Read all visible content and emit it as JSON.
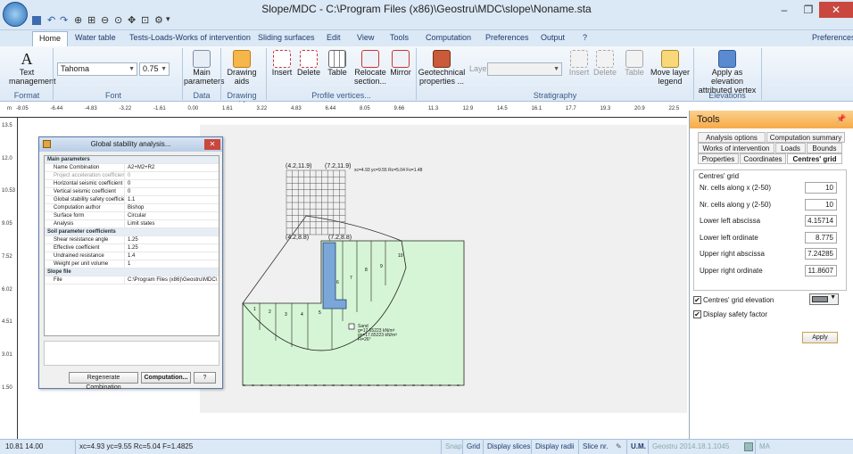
{
  "window": {
    "title": "Slope/MDC - C:\\Program Files (x86)\\Geostru\\MDC\\slope\\Noname.sta"
  },
  "tabs": [
    "Home",
    "Water table",
    "Tests-Loads-Works of intervention",
    "Sliding surfaces",
    "Edit",
    "View",
    "Tools",
    "Computation",
    "Preferences",
    "Output",
    "?"
  ],
  "preferences_link": "Preferences",
  "ribbon": {
    "text_management": "Text management",
    "font_name": "Tahoma",
    "font_size": "0.75",
    "main_parameters": "Main parameters",
    "drawing_aids": "Drawing aids",
    "insert": "Insert",
    "delete": "Delete",
    "table": "Table",
    "relocate_section": "Relocate section...",
    "mirror": "Mirror",
    "geotechnical_properties": "Geotechnical properties ...",
    "layer": "Layer",
    "insert2": "Insert",
    "delete2": "Delete",
    "table2": "Table",
    "move_layer_legend": "Move layer legend",
    "apply_elevation": "Apply as elevation attributed vertex",
    "groups": {
      "format": "Format",
      "font": "Font",
      "data": "Data",
      "drawing_aids": "Drawing aids",
      "profile": "Profile vertices...",
      "stratigraphy": "Stratigraphy",
      "elevations": "Elevations"
    }
  },
  "ruler": {
    "top": [
      "-8.05",
      "-6.44",
      "-4.83",
      "-3.22",
      "-1.61",
      "0.00",
      "1.61",
      "3.22",
      "4.83",
      "6.44",
      "8.05",
      "9.66",
      "11.3",
      "12.9",
      "14.5",
      "16.1",
      "17.7",
      "19.3",
      "20.9",
      "22.5"
    ],
    "top_unit": "m",
    "left": [
      "13.5",
      "12.0",
      "10.53",
      "9.05",
      "7.52",
      "6.02",
      "4.51",
      "3.01",
      "1.50"
    ]
  },
  "drawing": {
    "grid_ul": "(4.2,11.9)",
    "grid_ur": "(7.2,11.9)",
    "grid_ll": "(4.2,8.8)",
    "grid_lr": "(7.2,8.8)",
    "result_label": "xc=4.93 yc=9.55 Rc=5.04 Fs=1.48",
    "slices": [
      "1",
      "2",
      "3",
      "4",
      "5",
      "6",
      "7",
      "8",
      "9",
      "10"
    ],
    "soil_name": "Sand",
    "soil_lines": [
      "g=17.65223 kN/m³",
      "gs=17.65223 kN/m³",
      "Fi=26°"
    ]
  },
  "dialog": {
    "title": "Global stability analysis...",
    "close": "✕",
    "sections": [
      {
        "title": "Main parameters",
        "rows": [
          {
            "k": "Name Combination",
            "v": "A2+M2+R2",
            "dis": false
          },
          {
            "k": "Project acceleration coefficient",
            "v": "0",
            "dis": true
          },
          {
            "k": "Horizontal seismic coefficient",
            "v": "0",
            "dis": false
          },
          {
            "k": "Vertical seismic coefficient",
            "v": "0",
            "dis": false
          },
          {
            "k": "Global stability safety coefficient",
            "v": "1.1",
            "dis": false
          },
          {
            "k": "Computation author",
            "v": "Bishop",
            "dis": false
          },
          {
            "k": "Surface form",
            "v": "Circular",
            "dis": false
          },
          {
            "k": "Analysis",
            "v": "Limit states",
            "dis": false
          }
        ]
      },
      {
        "title": "Soil parameter coefficients",
        "rows": [
          {
            "k": "Shear resistance angle",
            "v": "1.25",
            "dis": false
          },
          {
            "k": "Effective coefficient",
            "v": "1.25",
            "dis": false
          },
          {
            "k": "Undrained resistance",
            "v": "1.4",
            "dis": false
          },
          {
            "k": "Weight per unit volume",
            "v": "1",
            "dis": false
          }
        ]
      },
      {
        "title": "Slope file",
        "rows": [
          {
            "k": "File",
            "v": "C:\\Program Files (x86)\\Geostru\\MDC\\",
            "dis": false
          }
        ]
      }
    ],
    "btn_regen": "Regenerate Combination",
    "btn_compute": "Computation...",
    "btn_help": "?"
  },
  "tools": {
    "title": "Tools",
    "pin": "ᵖ",
    "tabs_row1": [
      "Analysis options",
      "Computation summary"
    ],
    "tabs_row2": [
      "Works of intervention",
      "Loads",
      "Bounds"
    ],
    "tabs_row3": [
      "Properties",
      "Coordinates",
      "Centres' grid"
    ],
    "group_title": "Centres' grid",
    "fields": [
      {
        "label": "Nr. cells along x (2-50)",
        "value": "10"
      },
      {
        "label": "Nr. cells along y (2-50)",
        "value": "10"
      },
      {
        "label": "Lower left abscissa",
        "value": "4.15714"
      },
      {
        "label": "Lower left ordinate",
        "value": "8.775"
      },
      {
        "label": "Upper right abscissa",
        "value": "7.24285"
      },
      {
        "label": "Upper right ordinate",
        "value": "11.8607"
      }
    ],
    "chk_elevation": "Centres' grid elevation",
    "chk_safety": "Display safety factor",
    "apply": "Apply"
  },
  "status": {
    "coords": "10.81  14.00",
    "result": "xc=4.93 yc=9.55 Rc=5.04 F=1.4825",
    "snap": "Snap",
    "grid": "Grid",
    "display_slices": "Display slices",
    "display_radii": "Display radii",
    "slice_nr": "Slice nr.",
    "um": "U.M.",
    "version": "Geostru 2014.18.1.1045",
    "ma": "MA"
  },
  "colors": {
    "accent": "#1e3c6e",
    "soil": "#d6f5d6",
    "tools_header": "#f7aa47"
  }
}
